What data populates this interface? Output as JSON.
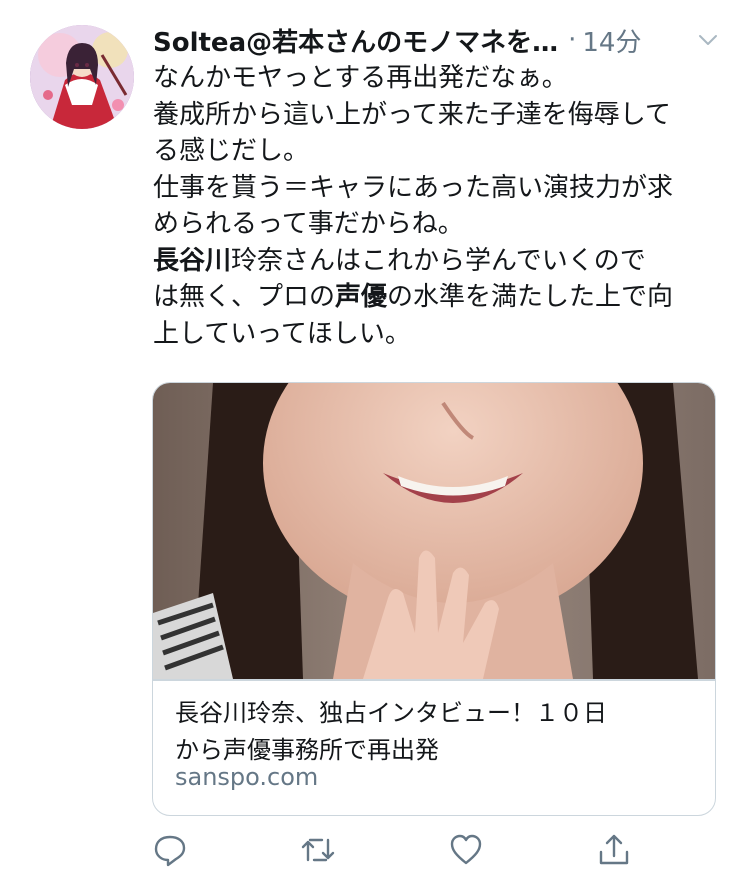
{
  "tweet": {
    "display_name": "Soltea@若本さんのモノマネを…",
    "separator": "·",
    "timestamp": "14分",
    "lines": [
      "なんかモヤっとする再出発だなぁ。",
      "養成所から這い上がって来た子達を侮辱して",
      "る感じだし。",
      "仕事を貰う＝キャラにあった高い演技力が求",
      "められるって事だからね。"
    ],
    "line6_bold": "長谷川",
    "line6_rest": "玲奈さんはこれから学んでいくので",
    "line7_pre": "は無く、プロの",
    "line7_bold": "声優",
    "line7_post": "の水準を満たした上で向",
    "line8": "上していってほしい。"
  },
  "card": {
    "title_line1": "長谷川玲奈、独占インタビュー！１０日",
    "title_line2": "から声優事務所で再出発",
    "domain": "sanspo.com"
  },
  "icons": {
    "menu": "chevron-down-icon",
    "reply": "reply-icon",
    "retweet": "retweet-icon",
    "like": "heart-icon",
    "share": "share-icon"
  },
  "colors": {
    "text": "#14171a",
    "secondary": "#657786",
    "border": "#ccd6dd"
  }
}
